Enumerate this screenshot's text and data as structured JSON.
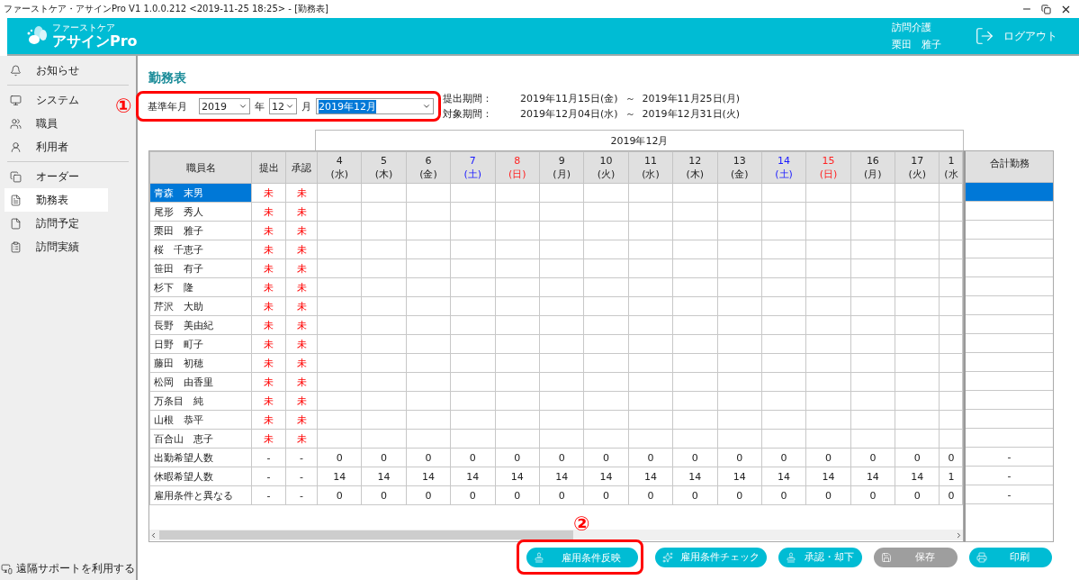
{
  "window": {
    "title": "ファーストケア・アサインPro V1 1.0.0.212 <2019-11-25 18:25> - [勤務表]"
  },
  "header": {
    "brand_small": "ファーストケア",
    "brand": "アサインPro",
    "office": "訪問介護",
    "user": "栗田　雅子",
    "logout": "ログアウト"
  },
  "sidebar": {
    "groups": [
      [
        {
          "label": "お知らせ",
          "selected": false
        }
      ],
      [
        {
          "label": "システム",
          "selected": false
        },
        {
          "label": "職員",
          "selected": false
        },
        {
          "label": "利用者",
          "selected": false
        }
      ],
      [
        {
          "label": "オーダー",
          "selected": false
        },
        {
          "label": "勤務表",
          "selected": true
        },
        {
          "label": "訪問予定",
          "selected": false
        },
        {
          "label": "訪問実績",
          "selected": false
        }
      ]
    ],
    "footer": {
      "label": "遠隔サポートを利用する"
    }
  },
  "page_title": "勤務表",
  "controls": {
    "annotation": "①",
    "label": "基準年月",
    "year": "2019",
    "year_unit": "年",
    "month": "12",
    "month_unit": "月",
    "period_select": "2019年12月"
  },
  "periods": [
    {
      "label": "提出期間：",
      "from": "2019年11月15日(金)",
      "separator": "～",
      "to": "2019年11月25日(月)"
    },
    {
      "label": "対象期間：",
      "from": "2019年12月04日(水)",
      "separator": "～",
      "to": "2019年12月31日(火)"
    }
  ],
  "table": {
    "month_band": "2019年12月",
    "columns": {
      "name": "職員名",
      "submitted": "提出",
      "approved": "承認",
      "total": "合計勤務"
    },
    "days": [
      {
        "date": "4",
        "weekday": "(水)",
        "kind": "weekday"
      },
      {
        "date": "5",
        "weekday": "(木)",
        "kind": "weekday"
      },
      {
        "date": "6",
        "weekday": "(金)",
        "kind": "weekday"
      },
      {
        "date": "7",
        "weekday": "(土)",
        "kind": "saturday"
      },
      {
        "date": "8",
        "weekday": "(日)",
        "kind": "sunday"
      },
      {
        "date": "9",
        "weekday": "(月)",
        "kind": "weekday"
      },
      {
        "date": "10",
        "weekday": "(火)",
        "kind": "weekday"
      },
      {
        "date": "11",
        "weekday": "(水)",
        "kind": "weekday"
      },
      {
        "date": "12",
        "weekday": "(木)",
        "kind": "weekday"
      },
      {
        "date": "13",
        "weekday": "(金)",
        "kind": "weekday"
      },
      {
        "date": "14",
        "weekday": "(土)",
        "kind": "saturday"
      },
      {
        "date": "15",
        "weekday": "(日)",
        "kind": "sunday"
      },
      {
        "date": "16",
        "weekday": "(月)",
        "kind": "weekday"
      },
      {
        "date": "17",
        "weekday": "(火)",
        "kind": "weekday"
      },
      {
        "date": "1",
        "weekday": "(水",
        "kind": "weekday"
      }
    ],
    "staff": [
      {
        "name": "青森　末男",
        "submitted": "未",
        "approved": "未",
        "selected": true
      },
      {
        "name": "尾形　秀人",
        "submitted": "未",
        "approved": "未",
        "selected": false
      },
      {
        "name": "栗田　雅子",
        "submitted": "未",
        "approved": "未",
        "selected": false
      },
      {
        "name": "桜　千恵子",
        "submitted": "未",
        "approved": "未",
        "selected": false
      },
      {
        "name": "笹田　有子",
        "submitted": "未",
        "approved": "未",
        "selected": false
      },
      {
        "name": "杉下　隆",
        "submitted": "未",
        "approved": "未",
        "selected": false
      },
      {
        "name": "芹沢　大助",
        "submitted": "未",
        "approved": "未",
        "selected": false
      },
      {
        "name": "長野　美由紀",
        "submitted": "未",
        "approved": "未",
        "selected": false
      },
      {
        "name": "日野　町子",
        "submitted": "未",
        "approved": "未",
        "selected": false
      },
      {
        "name": "藤田　初穂",
        "submitted": "未",
        "approved": "未",
        "selected": false
      },
      {
        "name": "松岡　由香里",
        "submitted": "未",
        "approved": "未",
        "selected": false
      },
      {
        "name": "万条目　純",
        "submitted": "未",
        "approved": "未",
        "selected": false
      },
      {
        "name": "山根　恭平",
        "submitted": "未",
        "approved": "未",
        "selected": false
      },
      {
        "name": "百合山　恵子",
        "submitted": "未",
        "approved": "未",
        "selected": false
      }
    ],
    "summary": [
      {
        "label": "出勤希望人数",
        "submitted": "-",
        "approved": "-",
        "values": [
          "0",
          "0",
          "0",
          "0",
          "0",
          "0",
          "0",
          "0",
          "0",
          "0",
          "0",
          "0",
          "0",
          "0",
          "0"
        ],
        "total": "-"
      },
      {
        "label": "休暇希望人数",
        "submitted": "-",
        "approved": "-",
        "values": [
          "14",
          "14",
          "14",
          "14",
          "14",
          "14",
          "14",
          "14",
          "14",
          "14",
          "14",
          "14",
          "14",
          "14",
          "1"
        ],
        "total": "-"
      },
      {
        "label": "雇用条件と異なる",
        "submitted": "-",
        "approved": "-",
        "values": [
          "0",
          "0",
          "0",
          "0",
          "0",
          "0",
          "0",
          "0",
          "0",
          "0",
          "0",
          "0",
          "0",
          "0",
          "0"
        ],
        "total": "-"
      }
    ]
  },
  "actions": {
    "annotation": "②",
    "buttons": [
      {
        "label": "雇用条件反映",
        "disabled": false,
        "highlighted": true
      },
      {
        "label": "雇用条件チェック",
        "disabled": false,
        "highlighted": false
      },
      {
        "label": "承認・却下",
        "disabled": false,
        "highlighted": false
      },
      {
        "label": "保存",
        "disabled": true,
        "highlighted": false
      },
      {
        "label": "印刷",
        "disabled": false,
        "highlighted": false
      }
    ]
  }
}
